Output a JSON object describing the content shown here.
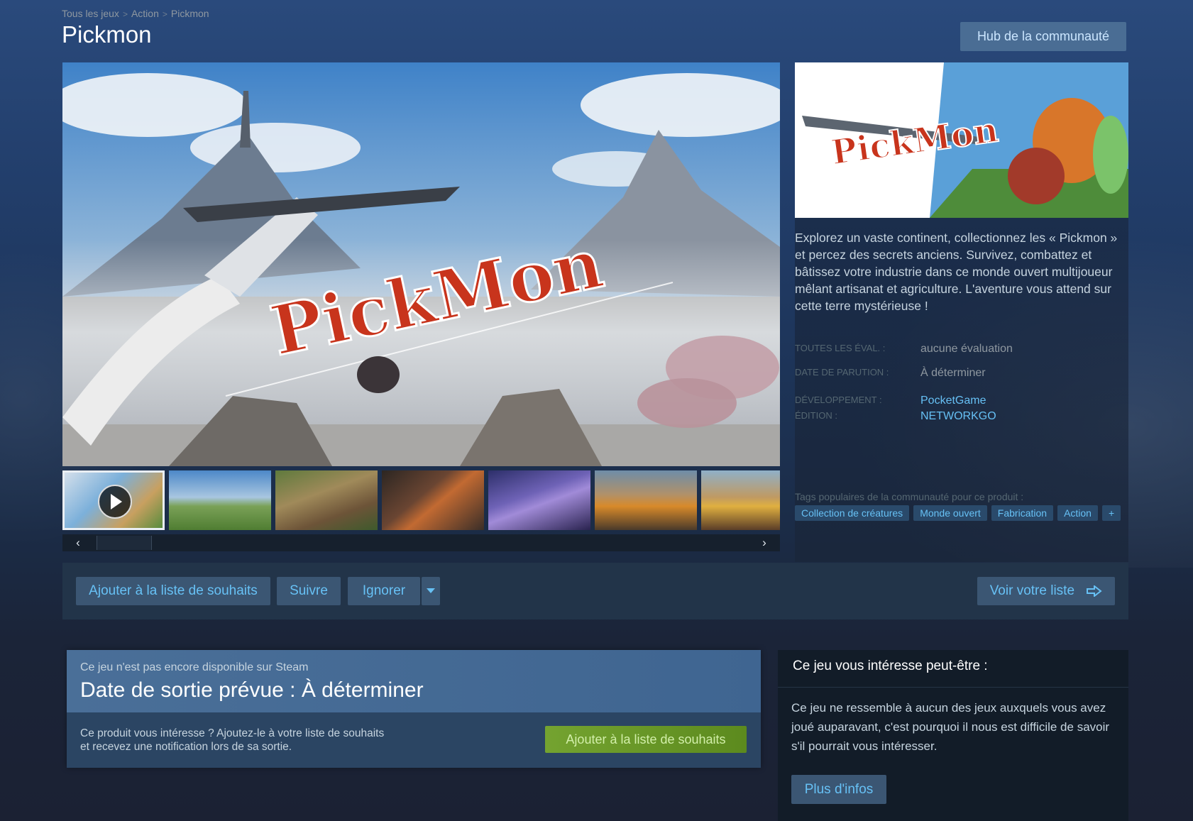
{
  "breadcrumb": {
    "items": [
      "Tous les jeux",
      "Action",
      "Pickmon"
    ],
    "separator": ">"
  },
  "page_title": "Pickmon",
  "hub_button": "Hub de la communauté",
  "media": {
    "main_logo_text": "PickMon",
    "capsule_logo_text": "PickMon",
    "thumbnail_count": 7,
    "selected_thumbnail": 0,
    "prev_icon": "chevron-left-icon",
    "next_icon": "chevron-right-icon",
    "play_icon": "play-icon"
  },
  "description": "Explorez un vaste continent, collectionnez les « Pickmon » et percez des secrets anciens. Survivez, combattez et bâtissez votre industrie dans ce monde ouvert multijoueur mêlant artisanat et agriculture. L'aventure vous attend sur cette terre mystérieuse !",
  "info": {
    "reviews_label": "TOUTES LES ÉVAL. :",
    "reviews_value": "aucune évaluation",
    "release_label": "DATE DE PARUTION :",
    "release_value": "À déterminer",
    "developer_label": "DÉVELOPPEMENT :",
    "developer_value": "PocketGame",
    "publisher_label": "ÉDITION :",
    "publisher_value": "NETWORKGO"
  },
  "tags_heading": "Tags populaires de la communauté pour ce produit :",
  "tags": [
    "Collection de créatures",
    "Monde ouvert",
    "Fabrication",
    "Action",
    "+"
  ],
  "actions": {
    "wishlist": "Ajouter à la liste de souhaits",
    "follow": "Suivre",
    "ignore": "Ignorer",
    "dropdown_icon": "caret-down-icon",
    "view_list": "Voir votre liste",
    "view_list_icon": "arrow-right-icon"
  },
  "purchase": {
    "subtitle": "Ce jeu n'est pas encore disponible sur Steam",
    "title": "Date de sortie prévue : À déterminer",
    "note": "Ce produit vous intéresse ? Ajoutez-le à votre liste de souhaits et recevez une notification lors de sa sortie.",
    "button": "Ajouter à la liste de souhaits"
  },
  "recommendation": {
    "heading": "Ce jeu vous intéresse peut-être :",
    "text": "Ce jeu ne ressemble à aucun des jeux auxquels vous avez joué auparavant, c'est pourquoi il nous est difficile de savoir s'il pourrait vous intéresser.",
    "button": "Plus d'infos"
  },
  "colors": {
    "link": "#66c0f4",
    "button_bg": "#3b5673",
    "button_text": "#67c1f5",
    "green_button": "#6b9a2b",
    "logo_red": "#c8341c"
  }
}
